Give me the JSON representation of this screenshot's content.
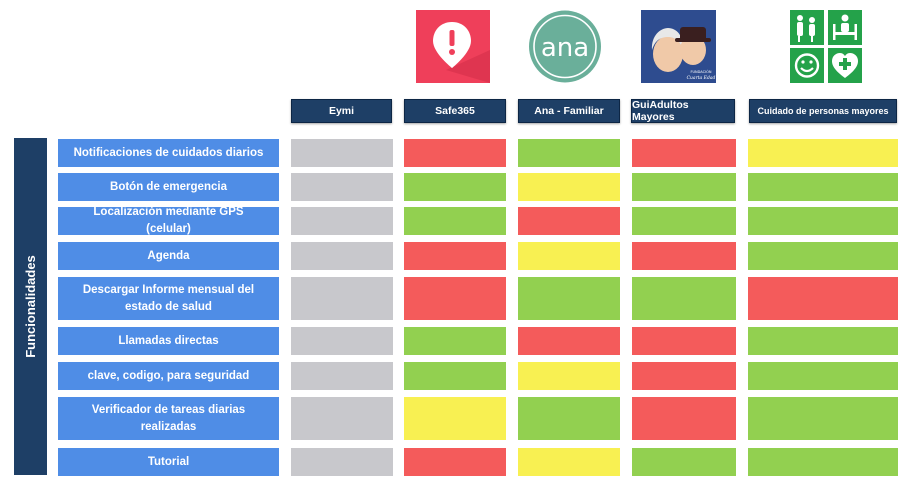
{
  "apps": [
    {
      "name": "Eymi",
      "logo": null
    },
    {
      "name": "Safe365",
      "logo": "safe365-logo-icon"
    },
    {
      "name": "Ana - Familiar",
      "logo": "ana-logo-icon"
    },
    {
      "name": "GuiAdultos Mayores",
      "logo": "guiadultos-logo-icon"
    },
    {
      "name": "Cuidado de personas mayores",
      "logo": "cuidado-logo-icon"
    }
  ],
  "logo_text": {
    "ana": "ana",
    "guiadultos_line1": "FUNDACIÓN",
    "guiadultos_line2": "Cuarta Edad"
  },
  "side_label": "Funcionalidades",
  "rows": [
    {
      "label": "Notificaciones de cuidados diarios",
      "status": [
        "gray",
        "red",
        "green",
        "red",
        "yellow"
      ]
    },
    {
      "label": "Botón de emergencia",
      "status": [
        "gray",
        "green",
        "yellow",
        "green",
        "green"
      ]
    },
    {
      "label": "Localización mediante GPS (celular)",
      "status": [
        "gray",
        "green",
        "red",
        "green",
        "green"
      ]
    },
    {
      "label": "Agenda",
      "status": [
        "gray",
        "red",
        "yellow",
        "red",
        "green"
      ]
    },
    {
      "label": "Descargar Informe mensual del estado de salud",
      "status": [
        "gray",
        "red",
        "green",
        "green",
        "red"
      ]
    },
    {
      "label": "Llamadas directas",
      "status": [
        "gray",
        "green",
        "red",
        "red",
        "green"
      ]
    },
    {
      "label": "clave, codigo, para seguridad",
      "status": [
        "gray",
        "green",
        "yellow",
        "red",
        "green"
      ]
    },
    {
      "label": "Verificador de tareas diarias realizadas",
      "status": [
        "gray",
        "yellow",
        "green",
        "red",
        "green"
      ]
    },
    {
      "label": "Tutorial",
      "status": [
        "gray",
        "red",
        "yellow",
        "green",
        "green"
      ]
    }
  ],
  "colors": {
    "header_bg": "#1e3f66",
    "row_label_bg": "#4f8de6",
    "gray": "#c8c8cc",
    "red": "#f45b5b",
    "green": "#92d050",
    "yellow": "#f8f052"
  }
}
